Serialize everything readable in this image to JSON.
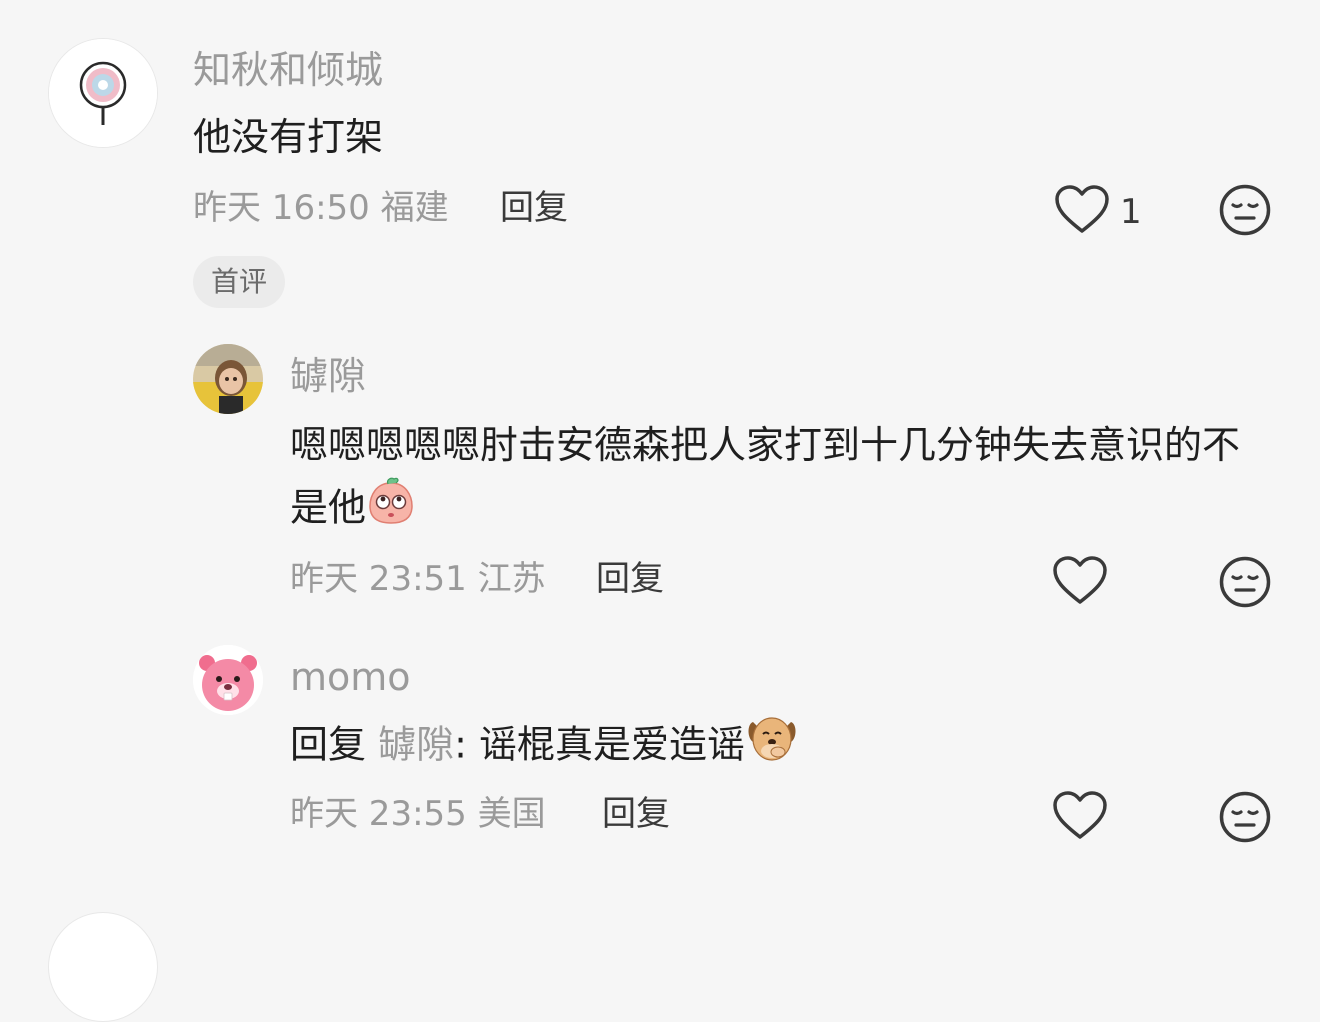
{
  "comments": [
    {
      "username": "知秋和倾城",
      "text": "他没有打架",
      "time": "昨天 16:50",
      "location": "福建",
      "reply_label": "回复",
      "likes": "1",
      "badge": "首评"
    },
    {
      "username": "罅隙",
      "text": "嗯嗯嗯嗯嗯肘击安德森把人家打到十几分钟失去意识的不是他",
      "emoji": "peach-face-eyes-up",
      "time": "昨天 23:51",
      "location": "江苏",
      "reply_label": "回复"
    },
    {
      "username": "momo",
      "reply_prefix": "回复",
      "reply_to": "罅隙",
      "text": ": 谣棍真是爱造谣",
      "emoji": "dog-face-covering-mouth",
      "time": "昨天 23:55",
      "location": "美国",
      "reply_label": "回复"
    }
  ],
  "icons": {
    "like": "heart-outline-icon",
    "dislike": "neutral-face-icon"
  },
  "colors": {
    "background": "#f6f6f6",
    "username": "#9a9a9a",
    "text": "#1f1f1f",
    "icon": "#3a3a3a"
  }
}
